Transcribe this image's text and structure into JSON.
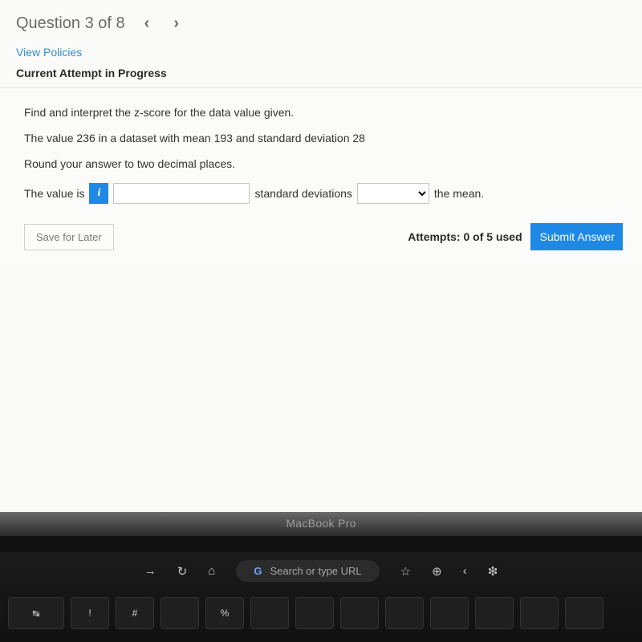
{
  "header": {
    "question_title": "Question 3 of 8"
  },
  "links": {
    "view_policies": "View Policies"
  },
  "labels": {
    "attempt_status": "Current Attempt in Progress"
  },
  "question": {
    "line1": "Find and interpret the z-score for the data value given.",
    "line2": "The value 236 in a dataset with mean 193 and standard deviation 28",
    "line3": "Round your answer to two decimal places."
  },
  "answer": {
    "prefix": "The value is",
    "info_badge": "i",
    "input_value": "",
    "mid_text": "standard deviations",
    "select_value": "",
    "suffix": "the mean."
  },
  "footer": {
    "save_label": "Save for Later",
    "attempts_text": "Attempts: 0 of 5 used",
    "submit_label": "Submit Answer"
  },
  "laptop": {
    "bezel": "MacBook Pro",
    "omnibox_placeholder": "Search or type URL"
  }
}
